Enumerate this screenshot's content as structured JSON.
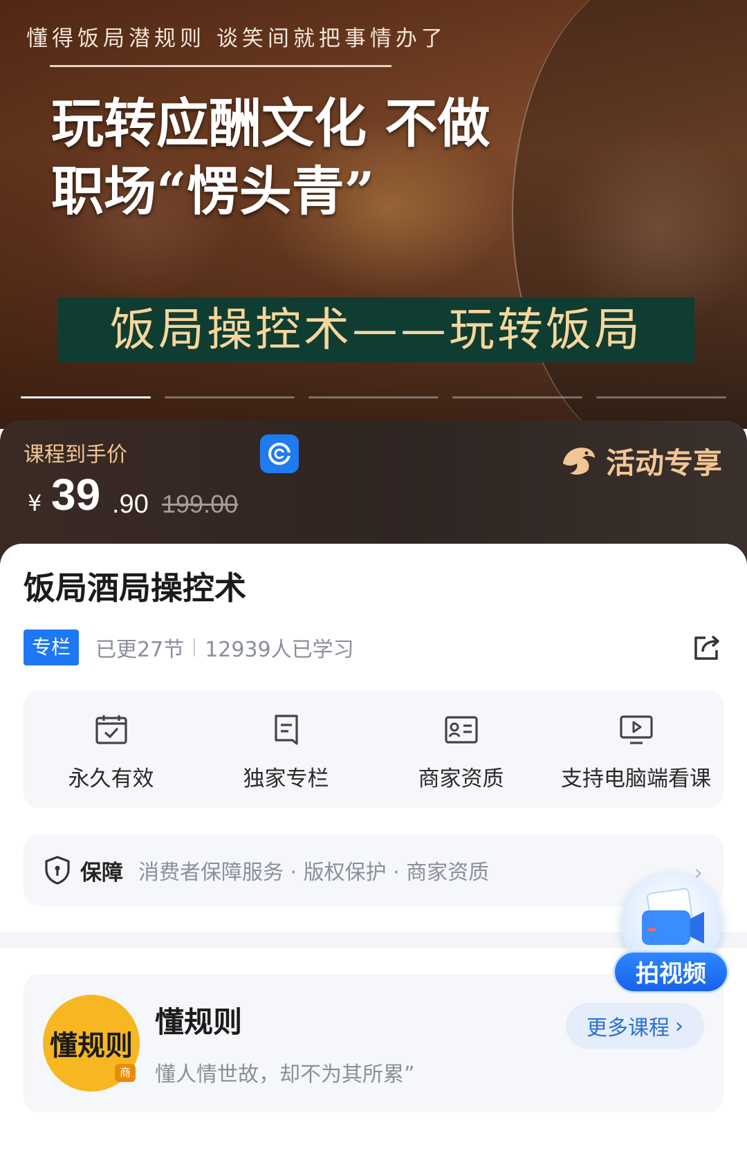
{
  "banner": {
    "tagline": "懂得饭局潜规则 谈笑间就把事情办了",
    "headline_line1": "玩转应酬文化 不做",
    "headline_line2": "职场“愣头青”",
    "strip": "饭局操控术——玩转饭局",
    "slides": [
      true,
      false,
      false,
      false,
      false
    ]
  },
  "price": {
    "label": "课程到手价",
    "currency": "¥",
    "integer": "39",
    "decimal": ".90",
    "original": "199.00",
    "promo": "活动专享"
  },
  "course": {
    "title": "饭局酒局操控术",
    "badge": "专栏",
    "updated": "已更27节",
    "learners": "12939人已学习"
  },
  "features": [
    {
      "label": "永久有效",
      "icon": "calendar-check-icon"
    },
    {
      "label": "独家专栏",
      "icon": "bookmark-icon"
    },
    {
      "label": "商家资质",
      "icon": "id-card-icon"
    },
    {
      "label": "支持电脑端看课",
      "icon": "monitor-play-icon"
    }
  ],
  "guarantee": {
    "title": "保障",
    "items": "消费者保障服务 · 版权保护 · 商家资质"
  },
  "author": {
    "logo_text": "懂规则",
    "logo_tag": "商",
    "name": "懂规则",
    "description": "懂人情世故，却不为其所累”",
    "more": "更多课程"
  },
  "float_button": {
    "label": "拍视频"
  },
  "colors": {
    "accent_blue": "#1e78f5",
    "promo_gold": "#f2c694",
    "strip_green": "#0f3d32",
    "logo_yellow": "#f6b722"
  }
}
